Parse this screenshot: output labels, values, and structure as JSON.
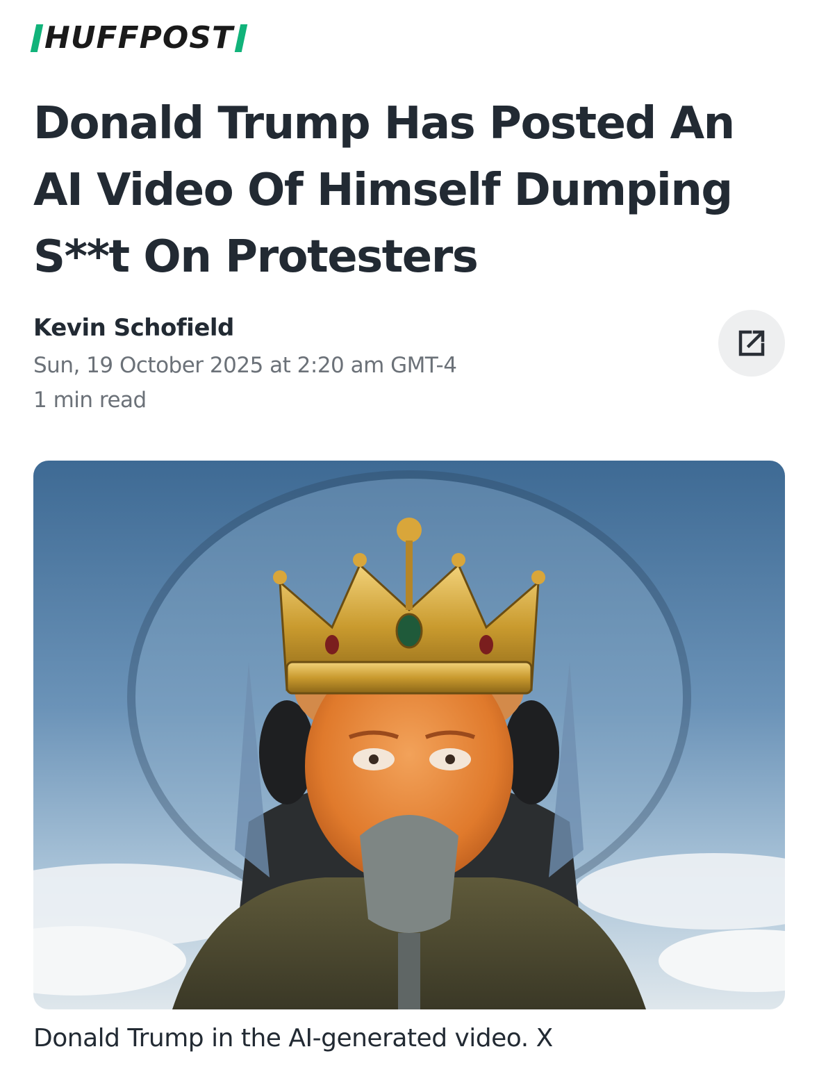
{
  "brand": {
    "name": "HUFFPOST",
    "accent": "#11b37a"
  },
  "article": {
    "headline": "Donald Trump Has Posted An AI Video Of Himself Dumping S**t On Protesters",
    "author": "Kevin Schofield",
    "published": "Sun, 19 October 2025 at 2:20 am GMT-4",
    "read_time": "1 min read"
  },
  "share": {
    "icon": "external-link-icon"
  },
  "image": {
    "caption": "Donald Trump in the AI-generated video. X",
    "subject": "crowned pilot in jet cockpit"
  }
}
